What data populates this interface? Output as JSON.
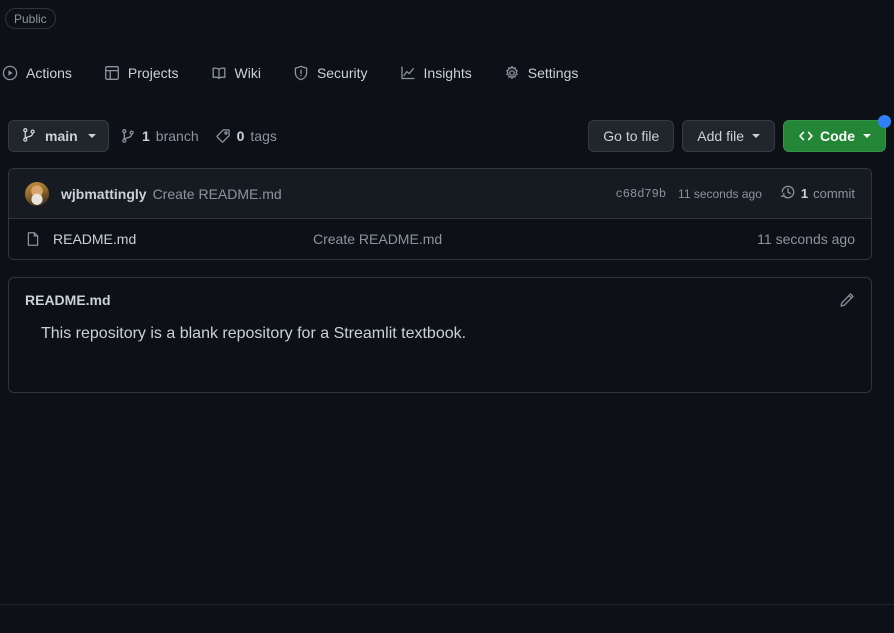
{
  "repo": {
    "visibility_label": "Public"
  },
  "nav": {
    "items": [
      {
        "label": "Actions",
        "icon": "play-circle-icon"
      },
      {
        "label": "Projects",
        "icon": "table-icon"
      },
      {
        "label": "Wiki",
        "icon": "book-icon"
      },
      {
        "label": "Security",
        "icon": "shield-icon"
      },
      {
        "label": "Insights",
        "icon": "graph-icon"
      },
      {
        "label": "Settings",
        "icon": "gear-icon"
      }
    ]
  },
  "toolbar": {
    "branch_name": "main",
    "branch_icon": "branch-icon",
    "branch_count": "1",
    "branch_count_label": "branch",
    "tag_count": "0",
    "tag_count_label": "tags",
    "tag_icon": "tag-icon",
    "go_to_file_label": "Go to file",
    "add_file_label": "Add file",
    "code_label": "Code",
    "code_icon": "code-brackets-icon",
    "code_button_color": "#238636",
    "cursor_dot_color": "#2f81f7"
  },
  "commit_header": {
    "avatar": "user-avatar",
    "author": "wjbmattingly",
    "message": "Create README.md",
    "sha": "c68d79b",
    "time": "11 seconds ago",
    "history_icon": "history-clock-icon",
    "commit_count": "1",
    "commit_count_label": "commit"
  },
  "files": {
    "columns": [
      "name",
      "last_commit",
      "last_updated"
    ],
    "rows": [
      {
        "icon": "file-icon",
        "name": "README.md",
        "last_commit": "Create README.md",
        "last_updated": "11 seconds ago"
      }
    ]
  },
  "readme": {
    "title": "README.md",
    "edit_icon": "pencil-icon",
    "body": "This repository is a blank repository for a Streamlit textbook."
  },
  "theme": {
    "background": "#0d1117",
    "surface": "#161b22",
    "border": "#30363d",
    "text_primary": "#c9d1d9",
    "text_muted": "#8b949e",
    "accent_green": "#238636",
    "accent_blue": "#2f81f7"
  }
}
